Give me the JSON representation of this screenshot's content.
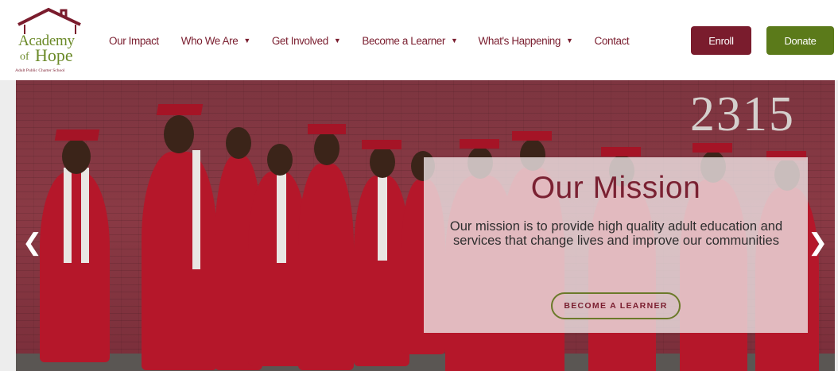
{
  "logo": {
    "line1": "Academy",
    "line2_of": "of",
    "line2": "Hope",
    "tagline": "Adult Public Charter School"
  },
  "nav": {
    "items": [
      {
        "label": "Our Impact",
        "dropdown": false
      },
      {
        "label": "Who We Are",
        "dropdown": true
      },
      {
        "label": "Get Involved",
        "dropdown": true
      },
      {
        "label": "Become a Learner",
        "dropdown": true
      },
      {
        "label": "What's Happening",
        "dropdown": true
      },
      {
        "label": "Contact",
        "dropdown": false
      }
    ],
    "caret": "▼"
  },
  "buttons": {
    "enroll": "Enroll",
    "donate": "Donate"
  },
  "hero": {
    "address_number": "2315",
    "title": "Our Mission",
    "text": "Our mission is to provide high quality adult education and services that change lives and improve our communities",
    "cta": "BECOME A LEARNER",
    "prev_arrow": "❮",
    "next_arrow": "❯"
  },
  "colors": {
    "maroon": "#7a1c2d",
    "olive": "#5b7a1a",
    "gown_red": "#b5172a"
  }
}
